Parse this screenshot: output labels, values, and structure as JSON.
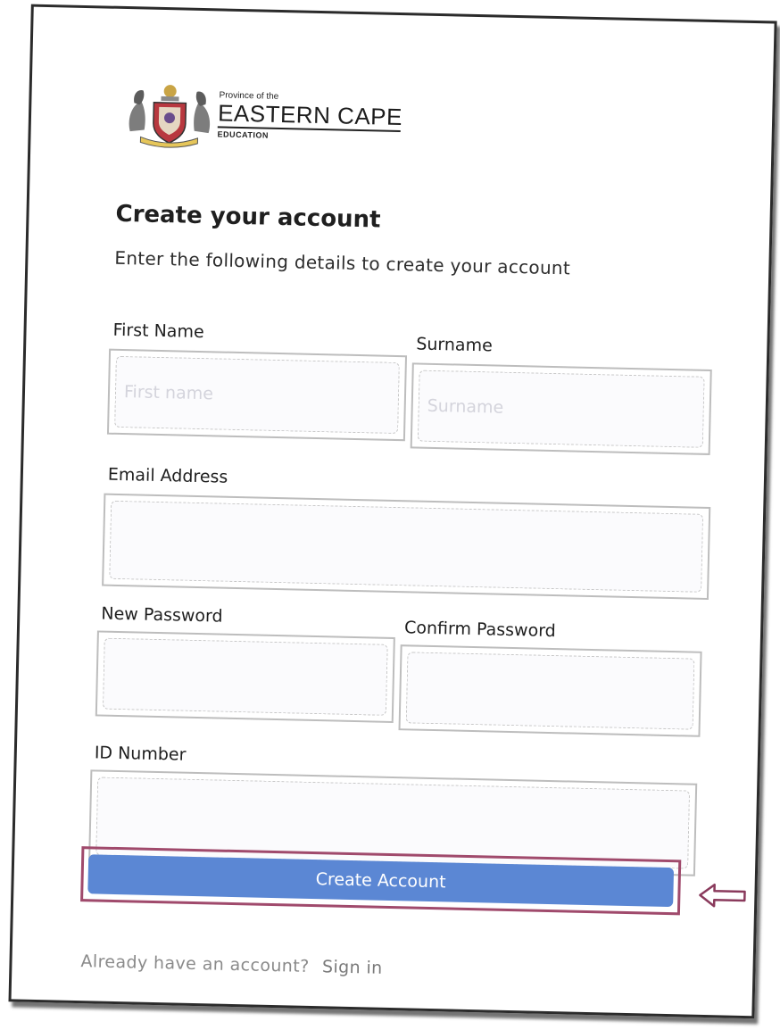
{
  "logo": {
    "province": "Province of the",
    "name": "EASTERN CAPE",
    "department": "EDUCATION"
  },
  "form": {
    "title": "Create your account",
    "subtitle": "Enter the following details to create your account",
    "first_name": {
      "label": "First Name",
      "placeholder": "First name",
      "value": ""
    },
    "surname": {
      "label": "Surname",
      "placeholder": "Surname",
      "value": ""
    },
    "email": {
      "label": "Email Address",
      "placeholder": "",
      "value": ""
    },
    "new_password": {
      "label": "New Password",
      "placeholder": "",
      "value": ""
    },
    "confirm_password": {
      "label": "Confirm Password",
      "placeholder": "",
      "value": ""
    },
    "id_number": {
      "label": "ID Number",
      "placeholder": "",
      "value": ""
    },
    "submit_label": "Create Account"
  },
  "footer": {
    "prompt": "Already have an account?",
    "signin_label": "Sign in"
  },
  "colors": {
    "button": "#5b87d4",
    "highlight": "#a04a6c"
  },
  "icons": {
    "coat_of_arms": "coat-of-arms-icon",
    "pointer": "left-arrow-icon"
  }
}
